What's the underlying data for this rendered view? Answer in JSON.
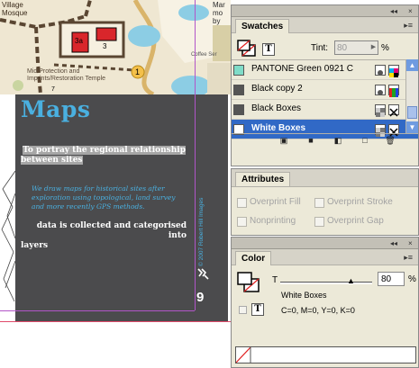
{
  "document": {
    "map": {
      "labels": {
        "village": "Village",
        "mosque": "Mosque",
        "building_3a": "3a",
        "building_3": "3",
        "marker_1": "1",
        "marker_7": "7",
        "caption_line1": "Mid Protection and",
        "caption_line2": "Imprints/Restoration Temple",
        "coffee_label": "Coffee Ser",
        "right_line1": "Mar",
        "right_line2": "mo",
        "right_line3": "by"
      }
    },
    "title": "Maps",
    "intro_line1": "To portray the regional relationship",
    "intro_line2": "between sites",
    "italic_paragraph": "We draw maps for historical sites after exploration using topological, land survey and more recently GPS methods.",
    "body_line1": "data is collected and categorised into",
    "body_line2": "layers",
    "vertical_credit": "© 2007 Robert Hill Images",
    "page_number": "9",
    "colors": {
      "title": "#4ab0e0",
      "dark_page": "#4b4b4d",
      "guide": "#b255c8"
    }
  },
  "swatches_panel": {
    "collapse_icon": "◂◂",
    "close_icon": "×",
    "tab": "Swatches",
    "menu_icon": "▸≡",
    "t_button": "T",
    "tint_label": "Tint:",
    "tint_value": "80",
    "tint_unit": "%",
    "items": [
      {
        "name": "PANTONE Green 0921 C",
        "color": "#7fdcc8",
        "selected": false
      },
      {
        "name": "Black copy 2",
        "color": "#555555",
        "selected": false
      },
      {
        "name": "Black Boxes",
        "color": "#555555",
        "selected": false
      },
      {
        "name": "White Boxes",
        "color": "#ffffff",
        "selected": true
      }
    ],
    "toolbar": {
      "show_all": "▣",
      "show_color": "■",
      "show_gradient": "◧",
      "new_swatch": "□",
      "delete_swatch": "🗑"
    }
  },
  "attributes_panel": {
    "tab": "Attributes",
    "options": {
      "overprint_fill": "Overprint Fill",
      "overprint_stroke": "Overprint Stroke",
      "nonprinting": "Nonprinting",
      "overprint_gap": "Overprint Gap"
    }
  },
  "color_panel": {
    "tab": "Color",
    "t_label": "T",
    "value": "80",
    "unit": "%",
    "swatch_name": "White Boxes",
    "cmyk": "C=0, M=0, Y=0, K=0",
    "t_button": "T"
  }
}
